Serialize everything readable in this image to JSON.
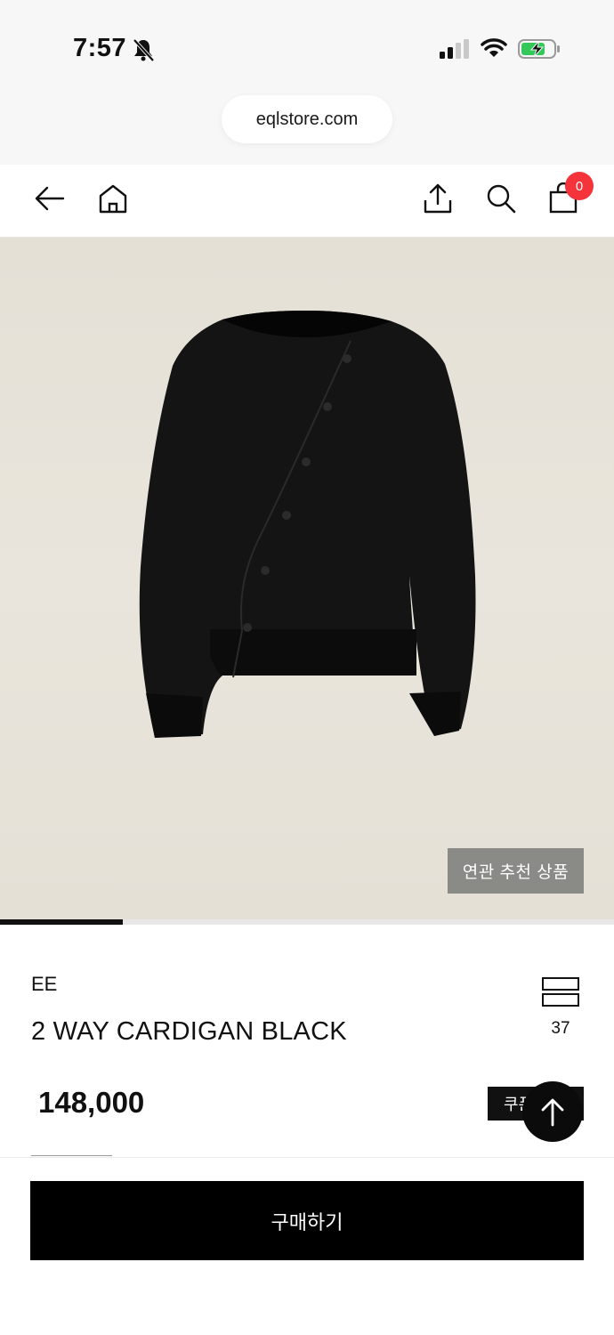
{
  "status_bar": {
    "time": "7:57",
    "icons": [
      "bell-off-icon",
      "cellular-signal-icon",
      "wifi-icon",
      "battery-charging-icon"
    ]
  },
  "browser": {
    "url": "eqlstore.com"
  },
  "nav": {
    "icons": [
      "back-arrow-icon",
      "home-icon",
      "share-icon",
      "search-icon",
      "cart-icon"
    ],
    "cart_count": "0"
  },
  "gallery": {
    "related_label": "연관 추천 상품",
    "progress_fraction": 0.2
  },
  "product": {
    "brand": "EE",
    "name": "2 WAY CARDIGAN BLACK",
    "price": "148,000",
    "wishlist_count": "37",
    "coupon_label": "쿠폰"
  },
  "actions": {
    "buy_label": "구매하기"
  },
  "colors": {
    "accent": "#000000",
    "badge": "#f4333a",
    "image_bg": "#e6e2d9"
  }
}
